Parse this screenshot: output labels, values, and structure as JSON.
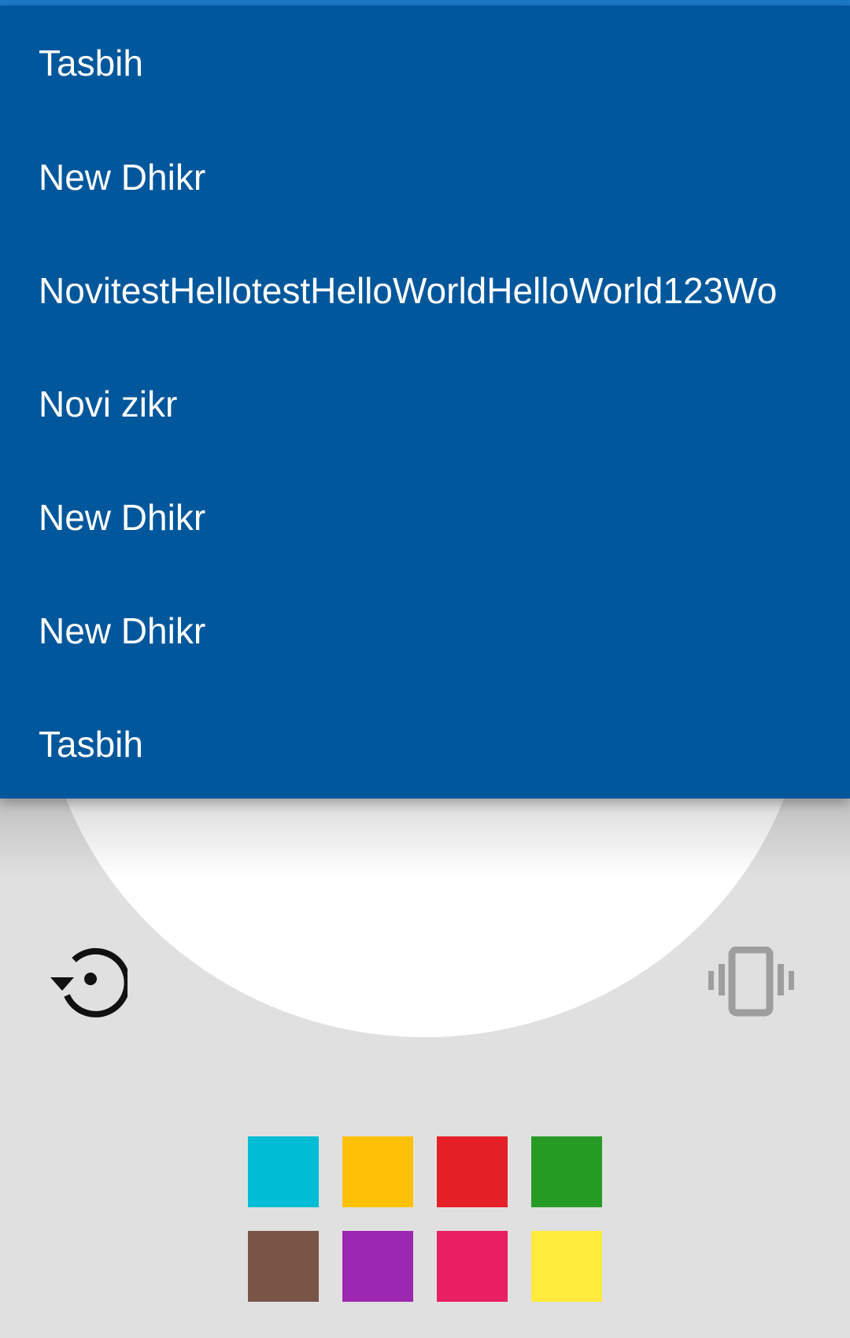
{
  "dropdown": {
    "items": [
      "Tasbih",
      "New Dhikr",
      "NovitestHellotestHelloWorldHelloWorld123Wo",
      "Novi zikr",
      "New Dhikr",
      "New Dhikr",
      "Tasbih"
    ]
  },
  "controls": {
    "reset_icon": "reset-counter-icon",
    "vibrate_icon": "vibration-icon"
  },
  "colors": {
    "dropdown_background": "#01579b",
    "screen_background": "#e0e0e0",
    "counter_circle": "#ffffff",
    "palette": [
      "#00bcd4",
      "#ffc107",
      "#e41f26",
      "#259b24",
      "#795548",
      "#9c27b0",
      "#e91e63",
      "#ffeb3b"
    ]
  }
}
